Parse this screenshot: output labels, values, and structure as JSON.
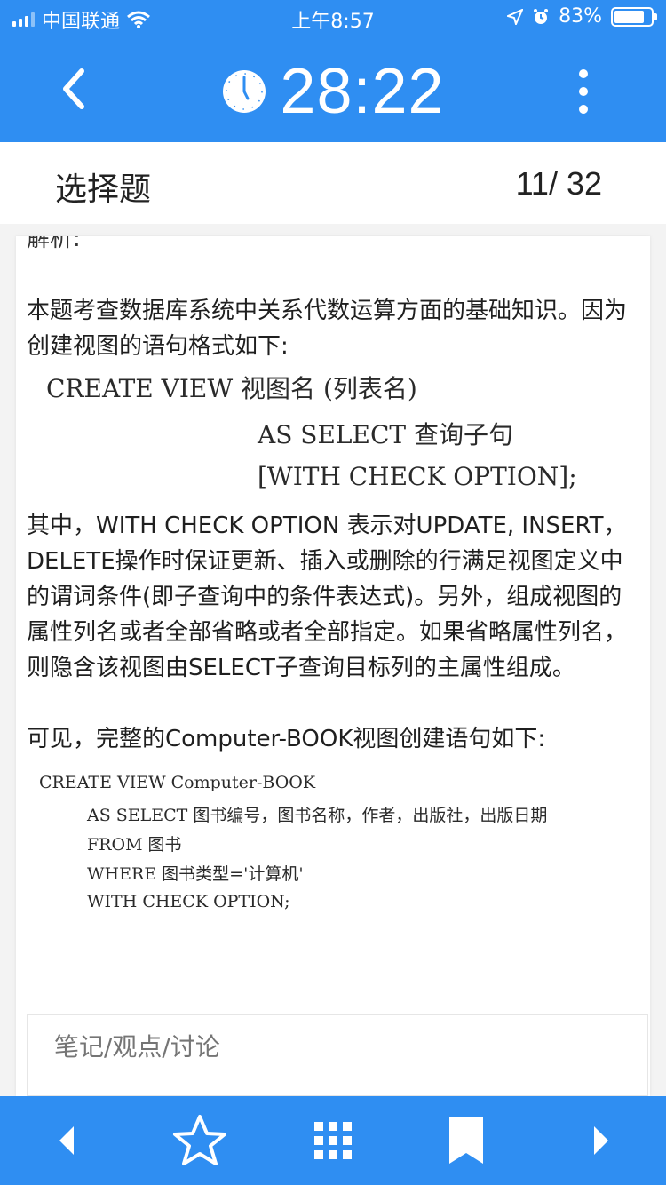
{
  "status_bar": {
    "carrier": "中国联通",
    "time": "上午8:57",
    "battery": "83%",
    "battery_level": 0.83
  },
  "header": {
    "back_icon": "chevron-left-icon",
    "clock_icon": "clock-icon",
    "timer": "28:22",
    "more_icon": "more-vertical-icon"
  },
  "question": {
    "type": "选择题",
    "counter": "11/ 32"
  },
  "analysis": {
    "cut_label": "解析:",
    "para1": "本题考查数据库系统中关系代数运算方面的基础知识。因为创建视图的语句格式如下:",
    "syntax": {
      "line1": "CREATE VIEW 视图名 (列表名)",
      "line2": "AS SELECT 查询子句",
      "line3": "[WITH CHECK OPTION];"
    },
    "para2": "其中，WITH CHECK OPTION 表示对UPDATE, INSERT，DELETE操作时保证更新、插入或删除的行满足视图定义中的谓词条件(即子查询中的条件表达式)。另外，组成视图的属性列名或者全部省略或者全部指定。如果省略属性列名，则隐含该视图由SELECT子查询目标列的主属性组成。",
    "para3": "可见，完整的Computer-BOOK视图创建语句如下:",
    "example": {
      "line1": "CREATE VIEW Computer-BOOK",
      "line2": "AS SELECT 图书编号，图书名称，作者，出版社，出版日期",
      "line3": "FROM 图书",
      "line4": "WHERE 图书类型='计算机'",
      "line5": "WITH CHECK OPTION;"
    }
  },
  "notes": {
    "placeholder": "笔记/观点/讨论"
  },
  "bottom_bar": {
    "prev_icon": "triangle-left-icon",
    "favorite_icon": "star-icon",
    "grid_icon": "grid-icon",
    "bookmark_icon": "bookmark-icon",
    "next_icon": "triangle-right-icon"
  },
  "colors": {
    "accent": "#2f8ef2"
  }
}
